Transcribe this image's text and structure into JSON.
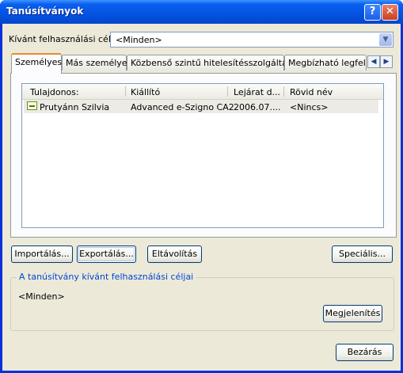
{
  "window": {
    "title": "Tanúsítványok",
    "help_label": "?",
    "close_label": "✕"
  },
  "purpose": {
    "label": "Kívánt felhasználási cél:",
    "value": "<Minden>"
  },
  "tabs": [
    {
      "label": "Személyes",
      "active": true
    },
    {
      "label": "Más személyek"
    },
    {
      "label": "Közbenső szintű hitelesítésszolgáltatók"
    },
    {
      "label": "Megbízható legfelső"
    }
  ],
  "tab_scroll": {
    "left": "◀",
    "right": "▶"
  },
  "list": {
    "columns": [
      "Tulajdonos:",
      "Kiállító",
      "Lejárat d...",
      "Rövid név"
    ],
    "rows": [
      {
        "owner": "Prutyánn Szilvia",
        "issuer": "Advanced e-Szigno CA2",
        "expiry": "2006.07....",
        "friendly_name": "<Nincs>",
        "icon": "certificate-icon"
      }
    ]
  },
  "buttons": {
    "import": "Importálás...",
    "export": "Exportálás...",
    "remove": "Eltávolítás",
    "advanced": "Speciális...",
    "view": "Megjelenítés",
    "close": "Bezárás"
  },
  "purposes_group": {
    "title": "A tanúsítvány kívánt felhasználási céljai",
    "value": "<Minden>"
  }
}
